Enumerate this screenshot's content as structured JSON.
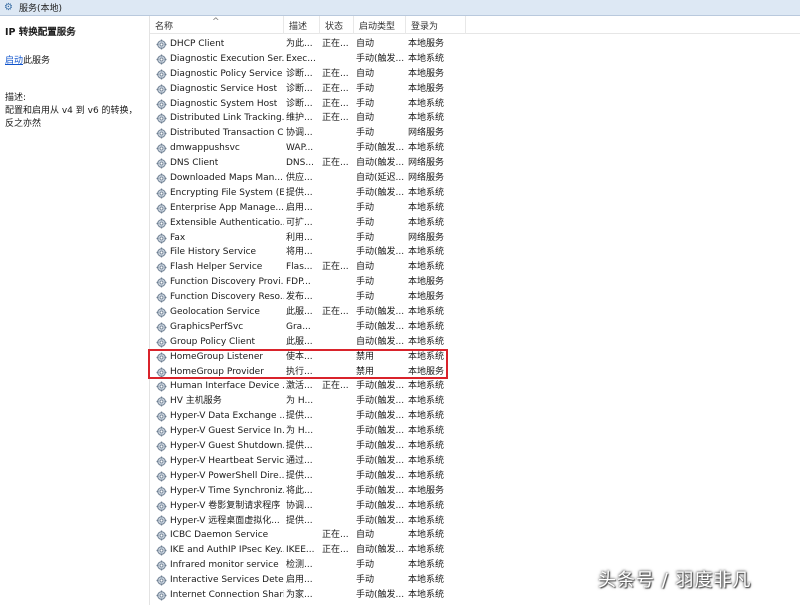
{
  "window": {
    "title": "服务(本地)"
  },
  "left_panel": {
    "service_title": "IP 转换配置服务",
    "start_link": "启动",
    "start_suffix": "此服务",
    "desc_label": "描述:",
    "desc_text": "配置和启用从 v4 到 v6 的转换，反之亦然"
  },
  "columns": {
    "name": "名称",
    "desc": "描述",
    "state": "状态",
    "startup": "启动类型",
    "logon": "登录为",
    "sort_indicator": "^"
  },
  "services": [
    {
      "name": "DHCP Client",
      "desc": "为此...",
      "state": "正在...",
      "startup": "自动",
      "logon": "本地服务"
    },
    {
      "name": "Diagnostic Execution Ser...",
      "desc": "Exec...",
      "state": "",
      "startup": "手动(触发...",
      "logon": "本地系统"
    },
    {
      "name": "Diagnostic Policy Service",
      "desc": "诊断...",
      "state": "正在...",
      "startup": "自动",
      "logon": "本地服务"
    },
    {
      "name": "Diagnostic Service Host",
      "desc": "诊断...",
      "state": "正在...",
      "startup": "手动",
      "logon": "本地服务"
    },
    {
      "name": "Diagnostic System Host",
      "desc": "诊断...",
      "state": "正在...",
      "startup": "手动",
      "logon": "本地系统"
    },
    {
      "name": "Distributed Link Tracking...",
      "desc": "维护...",
      "state": "正在...",
      "startup": "自动",
      "logon": "本地系统"
    },
    {
      "name": "Distributed Transaction C...",
      "desc": "协调...",
      "state": "",
      "startup": "手动",
      "logon": "网络服务"
    },
    {
      "name": "dmwappushsvc",
      "desc": "WAP...",
      "state": "",
      "startup": "手动(触发...",
      "logon": "本地系统"
    },
    {
      "name": "DNS Client",
      "desc": "DNS...",
      "state": "正在...",
      "startup": "自动(触发...",
      "logon": "网络服务"
    },
    {
      "name": "Downloaded Maps Man...",
      "desc": "供应...",
      "state": "",
      "startup": "自动(延迟...",
      "logon": "网络服务"
    },
    {
      "name": "Encrypting File System (E...",
      "desc": "提供...",
      "state": "",
      "startup": "手动(触发...",
      "logon": "本地系统"
    },
    {
      "name": "Enterprise App Manage...",
      "desc": "启用...",
      "state": "",
      "startup": "手动",
      "logon": "本地系统"
    },
    {
      "name": "Extensible Authenticatio...",
      "desc": "可扩...",
      "state": "",
      "startup": "手动",
      "logon": "本地系统"
    },
    {
      "name": "Fax",
      "desc": "利用...",
      "state": "",
      "startup": "手动",
      "logon": "网络服务"
    },
    {
      "name": "File History Service",
      "desc": "将用...",
      "state": "",
      "startup": "手动(触发...",
      "logon": "本地系统"
    },
    {
      "name": "Flash Helper Service",
      "desc": "Flas...",
      "state": "正在...",
      "startup": "自动",
      "logon": "本地系统"
    },
    {
      "name": "Function Discovery Provi...",
      "desc": "FDP...",
      "state": "",
      "startup": "手动",
      "logon": "本地服务"
    },
    {
      "name": "Function Discovery Reso...",
      "desc": "发布...",
      "state": "",
      "startup": "手动",
      "logon": "本地服务"
    },
    {
      "name": "Geolocation Service",
      "desc": "此服...",
      "state": "正在...",
      "startup": "手动(触发...",
      "logon": "本地系统"
    },
    {
      "name": "GraphicsPerfSvc",
      "desc": "Gra...",
      "state": "",
      "startup": "手动(触发...",
      "logon": "本地系统"
    },
    {
      "name": "Group Policy Client",
      "desc": "此服...",
      "state": "",
      "startup": "自动(触发...",
      "logon": "本地系统"
    },
    {
      "name": "HomeGroup Listener",
      "desc": "使本...",
      "state": "",
      "startup": "禁用",
      "logon": "本地系统"
    },
    {
      "name": "HomeGroup Provider",
      "desc": "执行...",
      "state": "",
      "startup": "禁用",
      "logon": "本地服务"
    },
    {
      "name": "Human Interface Device ...",
      "desc": "激活...",
      "state": "正在...",
      "startup": "手动(触发...",
      "logon": "本地系统"
    },
    {
      "name": "HV 主机服务",
      "desc": "为 H...",
      "state": "",
      "startup": "手动(触发...",
      "logon": "本地系统"
    },
    {
      "name": "Hyper-V Data Exchange ...",
      "desc": "提供...",
      "state": "",
      "startup": "手动(触发...",
      "logon": "本地系统"
    },
    {
      "name": "Hyper-V Guest Service In...",
      "desc": "为 H...",
      "state": "",
      "startup": "手动(触发...",
      "logon": "本地系统"
    },
    {
      "name": "Hyper-V Guest Shutdown...",
      "desc": "提供...",
      "state": "",
      "startup": "手动(触发...",
      "logon": "本地系统"
    },
    {
      "name": "Hyper-V Heartbeat Service",
      "desc": "通过...",
      "state": "",
      "startup": "手动(触发...",
      "logon": "本地系统"
    },
    {
      "name": "Hyper-V PowerShell Dire...",
      "desc": "提供...",
      "state": "",
      "startup": "手动(触发...",
      "logon": "本地系统"
    },
    {
      "name": "Hyper-V Time Synchroniz...",
      "desc": "将此...",
      "state": "",
      "startup": "手动(触发...",
      "logon": "本地服务"
    },
    {
      "name": "Hyper-V 卷影复制请求程序",
      "desc": "协调...",
      "state": "",
      "startup": "手动(触发...",
      "logon": "本地系统"
    },
    {
      "name": "Hyper-V 远程桌面虚拟化...",
      "desc": "提供...",
      "state": "",
      "startup": "手动(触发...",
      "logon": "本地系统"
    },
    {
      "name": "ICBC Daemon Service",
      "desc": "",
      "state": "正在...",
      "startup": "自动",
      "logon": "本地系统"
    },
    {
      "name": "IKE and AuthIP IPsec Key...",
      "desc": "IKEE...",
      "state": "正在...",
      "startup": "自动(触发...",
      "logon": "本地系统"
    },
    {
      "name": "Infrared monitor service",
      "desc": "检测...",
      "state": "",
      "startup": "手动",
      "logon": "本地系统"
    },
    {
      "name": "Interactive Services Dete...",
      "desc": "启用...",
      "state": "",
      "startup": "手动",
      "logon": "本地系统"
    },
    {
      "name": "Internet Connection Shari...",
      "desc": "为家...",
      "state": "",
      "startup": "手动(触发...",
      "logon": "本地系统"
    }
  ],
  "watermark": "头条号 / 羽度非凡",
  "colors": {
    "highlight": "#d9232b",
    "link": "#1155cc",
    "title_bar": "#dde8f4"
  }
}
